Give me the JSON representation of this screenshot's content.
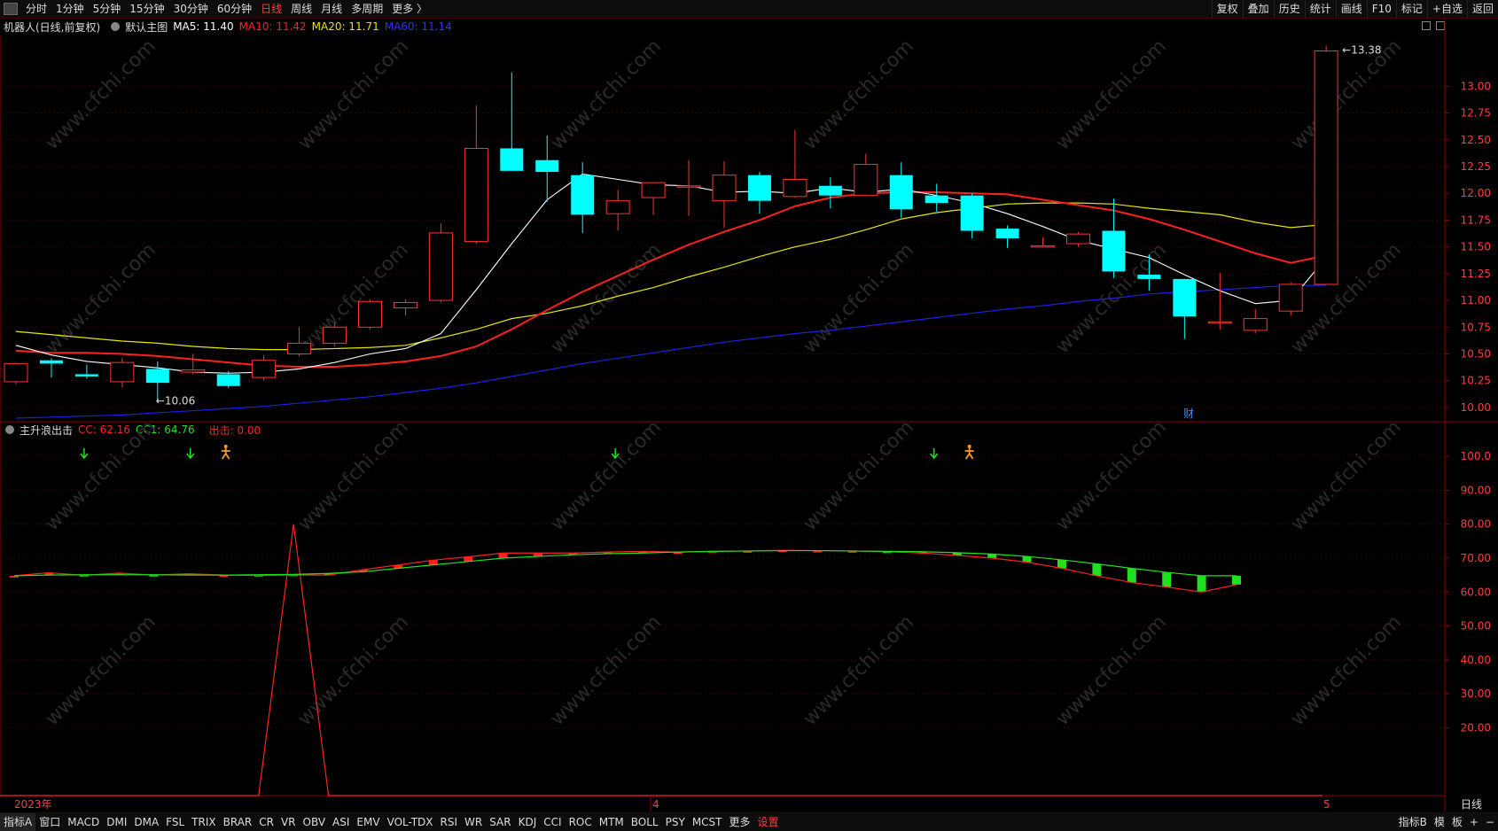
{
  "toolbar": {
    "periods": [
      "分时",
      "1分钟",
      "5分钟",
      "15分钟",
      "30分钟",
      "60分钟",
      "日线",
      "周线",
      "月线",
      "多周期",
      "更多 〉"
    ],
    "active_period": "日线",
    "right_items": [
      "复权",
      "叠加",
      "历史",
      "统计",
      "画线",
      "F10",
      "标记",
      "+自选",
      "返回"
    ]
  },
  "main_info": {
    "name": "机器人(日线,前复权)",
    "template": "默认主图",
    "ma5": "MA5: 11.40",
    "ma10": "MA10: 11.42",
    "ma20": "MA20: 11.71",
    "ma60": "MA60: 11.14"
  },
  "sub_info": {
    "name": "主升浪出击",
    "cc": "CC: 62.16",
    "cc1": "CC1: 64.76",
    "out": "出击: 0.00"
  },
  "price_axis": [
    "13.00",
    "12.75",
    "12.50",
    "12.25",
    "12.00",
    "11.75",
    "11.50",
    "11.25",
    "11.00",
    "10.75",
    "10.50",
    "10.25",
    "10.00"
  ],
  "sub_axis": [
    "100.0",
    "90.00",
    "80.00",
    "70.00",
    "60.00",
    "50.00",
    "40.00",
    "30.00",
    "20.00"
  ],
  "annotations": {
    "high": "13.38",
    "low": "10.06",
    "finance_tag": "财"
  },
  "time_labels": {
    "year": "2023年",
    "m4": "4",
    "m5": "5",
    "period": "日线"
  },
  "watermark": "www.cfchi.com",
  "colors": {
    "up": "#ff3232",
    "down": "#00ffff",
    "ma5": "#ffffff",
    "ma10": "#ff2020",
    "ma20": "#e6e600",
    "ma60": "#1e1ee6",
    "cc": "#ff2020",
    "cc1": "#20e020"
  },
  "bottom_tabs": [
    "指标A",
    "窗口",
    "MACD",
    "DMI",
    "DMA",
    "FSL",
    "TRIX",
    "BRAR",
    "CR",
    "VR",
    "OBV",
    "ASI",
    "EMV",
    "VOL-TDX",
    "RSI",
    "WR",
    "SAR",
    "KDJ",
    "CCI",
    "ROC",
    "MTM",
    "BOLL",
    "PSY",
    "MCST",
    "更多",
    "设置"
  ],
  "bottom_right": [
    "指标B",
    "模",
    "板",
    "+",
    "−"
  ],
  "chart_data": {
    "type": "candlestick",
    "ylim": [
      9.9,
      13.45
    ],
    "candles": [
      {
        "o": 10.24,
        "h": 10.42,
        "l": 10.22,
        "c": 10.41
      },
      {
        "o": 10.44,
        "h": 10.46,
        "l": 10.28,
        "c": 10.41
      },
      {
        "o": 10.31,
        "h": 10.4,
        "l": 10.27,
        "c": 10.29
      },
      {
        "o": 10.24,
        "h": 10.46,
        "l": 10.19,
        "c": 10.42
      },
      {
        "o": 10.36,
        "h": 10.43,
        "l": 10.06,
        "c": 10.23
      },
      {
        "o": 10.33,
        "h": 10.5,
        "l": 10.31,
        "c": 10.35
      },
      {
        "o": 10.31,
        "h": 10.34,
        "l": 10.18,
        "c": 10.2
      },
      {
        "o": 10.28,
        "h": 10.49,
        "l": 10.25,
        "c": 10.44
      },
      {
        "o": 10.5,
        "h": 10.75,
        "l": 10.48,
        "c": 10.6
      },
      {
        "o": 10.6,
        "h": 10.79,
        "l": 10.57,
        "c": 10.75
      },
      {
        "o": 10.75,
        "h": 11.01,
        "l": 10.73,
        "c": 10.99
      },
      {
        "o": 10.93,
        "h": 11.01,
        "l": 10.86,
        "c": 10.98
      },
      {
        "o": 11.0,
        "h": 11.72,
        "l": 10.98,
        "c": 11.63
      },
      {
        "o": 11.55,
        "h": 12.82,
        "l": 11.53,
        "c": 12.42
      },
      {
        "o": 12.42,
        "h": 13.13,
        "l": 12.33,
        "c": 12.21
      },
      {
        "o": 12.31,
        "h": 12.54,
        "l": 11.92,
        "c": 12.2
      },
      {
        "o": 12.17,
        "h": 12.29,
        "l": 11.63,
        "c": 11.8
      },
      {
        "o": 11.81,
        "h": 12.03,
        "l": 11.65,
        "c": 11.93
      },
      {
        "o": 11.96,
        "h": 12.1,
        "l": 11.8,
        "c": 12.1
      },
      {
        "o": 12.07,
        "h": 12.31,
        "l": 11.79,
        "c": 12.07
      },
      {
        "o": 11.93,
        "h": 12.3,
        "l": 11.68,
        "c": 12.17
      },
      {
        "o": 12.17,
        "h": 12.2,
        "l": 11.81,
        "c": 11.93
      },
      {
        "o": 11.97,
        "h": 12.59,
        "l": 11.96,
        "c": 12.13
      },
      {
        "o": 12.07,
        "h": 12.15,
        "l": 11.86,
        "c": 11.98
      },
      {
        "o": 11.98,
        "h": 12.37,
        "l": 11.98,
        "c": 12.27
      },
      {
        "o": 12.17,
        "h": 12.29,
        "l": 11.77,
        "c": 11.85
      },
      {
        "o": 11.98,
        "h": 12.09,
        "l": 11.83,
        "c": 11.91
      },
      {
        "o": 11.98,
        "h": 12.0,
        "l": 11.58,
        "c": 11.65
      },
      {
        "o": 11.67,
        "h": 11.7,
        "l": 11.49,
        "c": 11.58
      },
      {
        "o": 11.51,
        "h": 11.59,
        "l": 11.5,
        "c": 11.51
      },
      {
        "o": 11.53,
        "h": 11.64,
        "l": 11.5,
        "c": 11.62
      },
      {
        "o": 11.65,
        "h": 11.95,
        "l": 11.21,
        "c": 11.27
      },
      {
        "o": 11.24,
        "h": 11.43,
        "l": 11.09,
        "c": 11.2
      },
      {
        "o": 11.2,
        "h": 11.2,
        "l": 10.64,
        "c": 10.85
      },
      {
        "o": 10.8,
        "h": 11.26,
        "l": 10.73,
        "c": 10.8
      },
      {
        "o": 10.72,
        "h": 10.92,
        "l": 10.69,
        "c": 10.83
      },
      {
        "o": 10.9,
        "h": 11.17,
        "l": 10.86,
        "c": 11.15
      },
      {
        "o": 11.15,
        "h": 13.38,
        "l": 11.15,
        "c": 13.33
      }
    ],
    "ma5": [
      10.58,
      10.49,
      10.43,
      10.4,
      10.37,
      10.33,
      10.32,
      10.33,
      10.36,
      10.42,
      10.5,
      10.55,
      10.69,
      11.1,
      11.53,
      11.94,
      12.18,
      12.13,
      12.08,
      12.07,
      12.01,
      12.02,
      12.0,
      12.05,
      12.01,
      12.04,
      11.98,
      11.91,
      11.81,
      11.69,
      11.56,
      11.48,
      11.4,
      11.24,
      11.09,
      10.97,
      11.0,
      11.4
    ],
    "ma10": [
      10.53,
      10.51,
      10.51,
      10.5,
      10.48,
      10.45,
      10.42,
      10.39,
      10.38,
      10.38,
      10.4,
      10.43,
      10.48,
      10.57,
      10.73,
      10.91,
      11.08,
      11.23,
      11.38,
      11.52,
      11.64,
      11.75,
      11.88,
      11.96,
      12.0,
      12.01,
      12.01,
      12.0,
      11.99,
      11.94,
      11.89,
      11.84,
      11.76,
      11.66,
      11.55,
      11.44,
      11.35,
      11.42
    ],
    "ma20": [
      10.71,
      10.68,
      10.65,
      10.62,
      10.6,
      10.57,
      10.55,
      10.54,
      10.54,
      10.55,
      10.56,
      10.58,
      10.65,
      10.73,
      10.83,
      10.88,
      10.95,
      11.04,
      11.12,
      11.22,
      11.31,
      11.41,
      11.5,
      11.57,
      11.66,
      11.76,
      11.82,
      11.86,
      11.9,
      11.91,
      11.91,
      11.9,
      11.86,
      11.83,
      11.8,
      11.73,
      11.68,
      11.71
    ],
    "ma60": [
      9.9,
      9.91,
      9.92,
      9.93,
      9.95,
      9.97,
      9.99,
      10.01,
      10.04,
      10.07,
      10.1,
      10.14,
      10.18,
      10.23,
      10.29,
      10.35,
      10.41,
      10.46,
      10.51,
      10.56,
      10.61,
      10.65,
      10.69,
      10.72,
      10.76,
      10.8,
      10.84,
      10.88,
      10.92,
      10.95,
      10.99,
      11.02,
      11.06,
      11.08,
      11.1,
      11.12,
      11.14,
      11.14
    ],
    "sub": {
      "ylim": [
        0,
        105
      ],
      "cc": [
        64.8,
        65.7,
        64.9,
        65.6,
        65.0,
        65.4,
        65.0,
        64.9,
        65.0,
        65.0,
        66.6,
        68.0,
        69.4,
        70.4,
        71.5,
        71.5,
        71.5,
        71.8,
        72.0,
        71.8,
        72.0,
        72.1,
        72.3,
        72.2,
        72.1,
        71.9,
        71.5,
        70.8,
        70.0,
        68.8,
        67.0,
        64.8,
        62.8,
        61.5,
        60.0,
        62.2
      ],
      "cc1": [
        64.8,
        65.0,
        65.1,
        65.1,
        65.1,
        65.0,
        65.0,
        65.1,
        65.2,
        65.5,
        66.0,
        67.0,
        68.0,
        69.0,
        70.0,
        70.5,
        71.0,
        71.3,
        71.5,
        71.8,
        72.0,
        72.1,
        72.2,
        72.2,
        72.1,
        72.0,
        71.9,
        71.6,
        71.2,
        70.5,
        69.5,
        68.3,
        67.0,
        65.8,
        64.8,
        64.8
      ],
      "spike": {
        "start": 7,
        "peak": 8,
        "end": 9,
        "value": 80.0
      },
      "arrows_down": [
        2,
        5,
        17,
        26
      ],
      "arrows_person": [
        6,
        27
      ]
    }
  }
}
